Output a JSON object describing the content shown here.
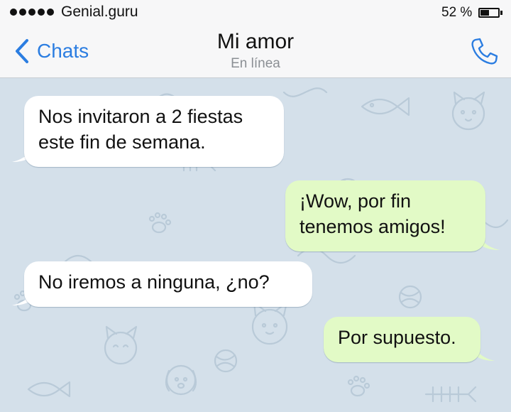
{
  "status_bar": {
    "carrier": "Genial.guru",
    "battery_text": "52 %",
    "battery_level": 0.52
  },
  "nav": {
    "back_label": "Chats",
    "title": "Mi amor",
    "subtitle": "En línea",
    "accent_color": "#2b7de1"
  },
  "chat": {
    "background_color": "#d4e0ea",
    "incoming_bubble_color": "#ffffff",
    "outgoing_bubble_color": "#e2fac6",
    "messages": [
      {
        "direction": "incoming",
        "lines": [
          "Nos invitaron a 2 fiestas",
          "este fin de semana."
        ]
      },
      {
        "direction": "outgoing",
        "lines": [
          "¡Wow, por fin",
          "tenemos amigos!"
        ]
      },
      {
        "direction": "incoming",
        "lines": [
          "No iremos a ninguna, ¿no?"
        ]
      },
      {
        "direction": "outgoing",
        "lines": [
          "Por supuesto."
        ]
      }
    ]
  },
  "icons": {
    "back": "chevron-left-icon",
    "call": "phone-icon",
    "signal": "signal-dots-icon",
    "battery": "battery-icon"
  }
}
